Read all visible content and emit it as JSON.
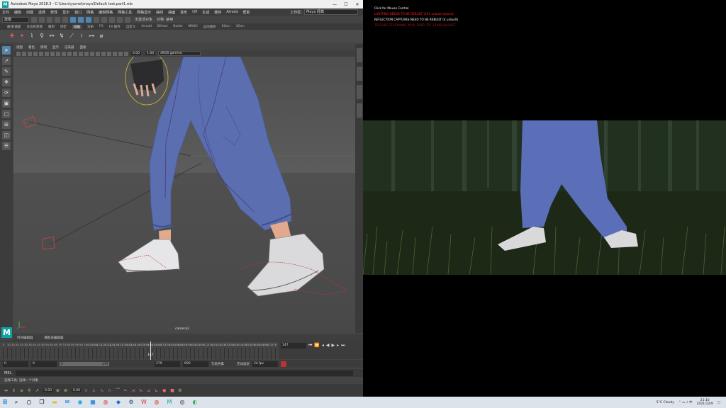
{
  "maya": {
    "title": "Autodesk Maya 2018.3 - C:\\Users\\yumei\\maya\\Default test.part1.mb",
    "menus": [
      "文件",
      "编辑",
      "创建",
      "选择",
      "修改",
      "显示",
      "窗口",
      "网格",
      "编辑网格",
      "网格工具",
      "网格显示",
      "曲线",
      "曲面",
      "变形",
      "UV",
      "生成",
      "缓存",
      "Arnold",
      "帮助"
    ],
    "workspace_label": "工作区:",
    "workspace_value": "Maya 经典",
    "mode_value": "建模",
    "status_text": "无激活对象",
    "symmetry_text": "对称: 禁用",
    "shelf_tabs": [
      "曲线/曲面",
      "多边形建模",
      "雕刻",
      "绑定",
      "动画",
      "渲染",
      "FX",
      "FX 缓存",
      "自定义",
      "Arnold",
      "Bifrost",
      "Bullet",
      "MASH",
      "运动图形",
      "XGen",
      "XGen"
    ],
    "active_shelf_tab": "动画",
    "viewport_menu": [
      "视图",
      "着色",
      "照明",
      "显示",
      "渲染器",
      "面板"
    ],
    "viewport_values": {
      "exposure": "0.00",
      "gamma": "1.00",
      "color_space": "sRGB gamma"
    },
    "camera_label": "camera2",
    "timeline_tabs": [
      "时间编辑器",
      "摄影表编辑器"
    ],
    "timeline_numbers": [
      "5",
      "10",
      "15",
      "20",
      "25",
      "30",
      "35",
      "40",
      "45",
      "50",
      "55",
      "60",
      "65",
      "70",
      "75",
      "80",
      "85",
      "90",
      "95",
      "100",
      "104",
      "108",
      "112",
      "116",
      "120",
      "124",
      "128",
      "132",
      "136",
      "140",
      "144",
      "148",
      "152",
      "156",
      "160",
      "164",
      "168",
      "172",
      "176",
      "180",
      "184",
      "188",
      "192",
      "196",
      "200",
      "204",
      "208",
      "212",
      "216",
      "220",
      "224",
      "228",
      "232",
      "236",
      "240",
      "244",
      "248",
      "252",
      "256",
      "260",
      "264",
      "268",
      "272",
      "276"
    ],
    "current_frame": "147",
    "current_frame_field": "147",
    "range": {
      "start": "0",
      "inner_start": "0",
      "bar_start": "0",
      "bar_end": "279",
      "inner_end": "279",
      "end": "600"
    },
    "char_set": "无角色集",
    "anim_layer": "无动画层",
    "fps": "24 fps",
    "mel_label": "MEL",
    "help_text": "选择工具: 选择一个对象",
    "bottom_values": {
      "v1": "0.50",
      "v2": "0.00"
    }
  },
  "unreal": {
    "click_label": "Click for Mouse Control",
    "msg_lighting": "LIGHTING NEEDS TO BE REBUILT (193 unbuilt objects)",
    "msg_reflection": "REFLECTION CAPTURES NEED TO BE REBUILT (4 unbuilt)",
    "msg_texture": "TEXTURE STREAMING POOL OVER 787.33 MiB BUDGET"
  },
  "taskbar": {
    "weather": "5°C Cloudy",
    "time": "21:10",
    "date": "2021/12/9"
  },
  "colors": {
    "maya_teal": "#0fa3a3",
    "ue_warning_red": "#ff2020",
    "pants_blue": "#5b6fb0"
  }
}
